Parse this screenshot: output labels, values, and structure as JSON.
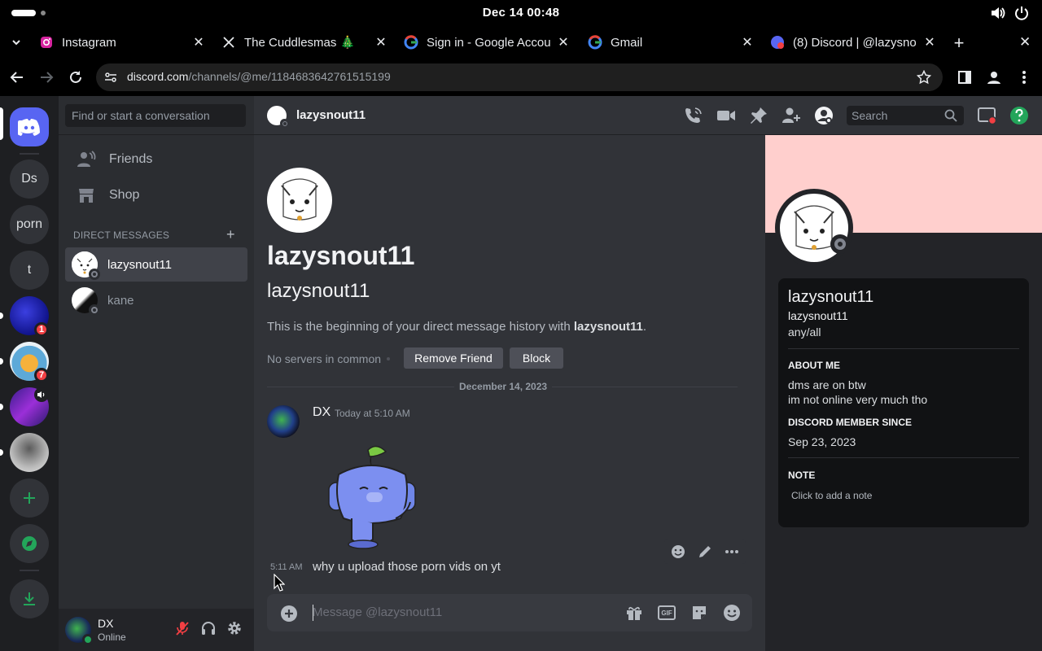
{
  "system": {
    "datetime": "Dec 14  00:48"
  },
  "browser": {
    "tabs": [
      {
        "title": "Instagram",
        "icon": "instagram-icon",
        "active": false
      },
      {
        "title": "The Cuddlesmas 🎄",
        "icon": "x-icon",
        "active": false
      },
      {
        "title": "Sign in - Google Accou",
        "icon": "google-icon",
        "active": false
      },
      {
        "title": "Gmail",
        "icon": "google-icon",
        "active": false
      },
      {
        "title": "(8) Discord | @lazysno",
        "icon": "discord-icon",
        "active": true
      }
    ],
    "new_tab": "+",
    "url_domain": "discord.com",
    "url_path": "/channels/@me/1184683642761515199"
  },
  "servers": [
    {
      "label": "Ds"
    },
    {
      "label": "porn"
    },
    {
      "label": "t"
    },
    {
      "label": "",
      "badge": "1"
    },
    {
      "label": "",
      "badge": "7"
    },
    {
      "label": "",
      "badge": ""
    },
    {
      "label": ""
    }
  ],
  "sidebar": {
    "search_placeholder": "Find or start a conversation",
    "friends": "Friends",
    "shop": "Shop",
    "dm_header": "DIRECT MESSAGES",
    "dms": [
      {
        "name": "lazysnout11",
        "selected": true
      },
      {
        "name": "kane",
        "selected": false
      }
    ],
    "user": {
      "name": "DX",
      "status": "Online"
    }
  },
  "header": {
    "username": "lazysnout11",
    "search_placeholder": "Search"
  },
  "intro": {
    "display_name": "lazysnout11",
    "username": "lazysnout11",
    "beginning_text": "This is the beginning of your direct message history with ",
    "beginning_name": "lazysnout11",
    "beginning_end": ".",
    "mutual": "No servers in common",
    "remove_friend": "Remove Friend",
    "block": "Block"
  },
  "messages": {
    "date_divider": "December 14, 2023",
    "author": "DX",
    "timestamp": "Today at 5:10 AM",
    "followup_time": "5:11 AM",
    "followup_text": "why u upload those porn vids on yt"
  },
  "composer": {
    "placeholder": "Message @lazysnout11",
    "gif": "GIF"
  },
  "profile": {
    "display_name": "lazysnout11",
    "username": "lazysnout11",
    "pronouns": "any/all",
    "about_title": "ABOUT ME",
    "about_lines": [
      "dms are on btw",
      "im not online very much tho"
    ],
    "member_title": "DISCORD MEMBER SINCE",
    "member_since": "Sep 23, 2023",
    "note_title": "NOTE",
    "note_placeholder": "Click to add a note",
    "banner_color": "#ffcfcd"
  },
  "colors": {
    "blurple": "#5865f2",
    "green": "#23a55a",
    "red": "#f23f43"
  }
}
